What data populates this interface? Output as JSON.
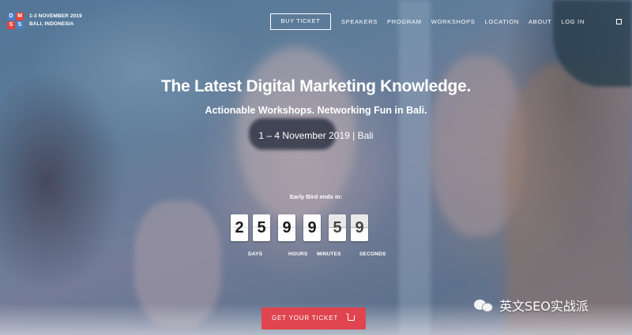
{
  "logo": {
    "letters": [
      "D",
      "M",
      "S",
      "S"
    ],
    "line1": "1-3 NOVEMBER 2019",
    "line2": "BALI, INDONESIA"
  },
  "header": {
    "buy_label": "BUY TICKET",
    "nav": [
      "SPEAKERS",
      "PROGRAM",
      "WORKSHOPS",
      "LOCATION",
      "ABOUT",
      "LOG IN"
    ],
    "menu_icon": "square-menu-icon"
  },
  "hero": {
    "title": "The Latest Digital Marketing Knowledge.",
    "subtitle": "Actionable Workshops. Networking Fun in Bali.",
    "date": "1 – 4 November 2019 | Bali"
  },
  "countdown": {
    "label": "Early Bird ends in:",
    "digits": [
      "2",
      "5",
      "9",
      "9",
      "5",
      "9"
    ],
    "units": [
      "DAYS",
      "HOURS",
      "MINUTES",
      "SECONDS"
    ]
  },
  "cta": {
    "label": "GET YOUR TICKET",
    "icon": "cart-icon"
  },
  "watermark": {
    "text": "英文SEO实战派",
    "icon": "wechat-icon"
  },
  "colors": {
    "accent": "#e0454f",
    "logo_blue": "#4a7fc1",
    "logo_red": "#e0443d"
  }
}
